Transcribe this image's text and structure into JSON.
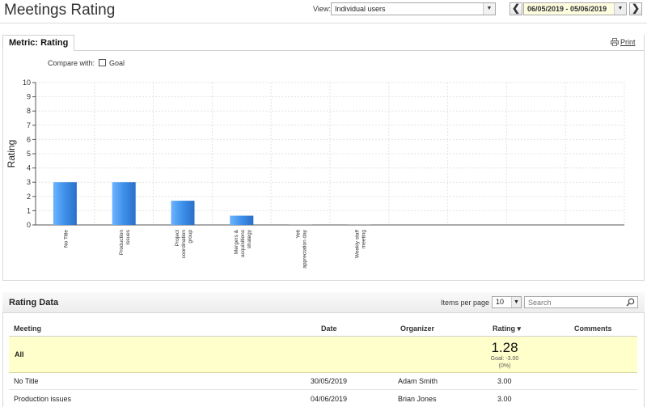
{
  "header": {
    "title": "Meetings Rating",
    "view_label": "View:",
    "view_value": "Individual users",
    "date_range": "06/05/2019 - 05/06/2019",
    "prev_glyph": "❮",
    "next_glyph": "❯"
  },
  "chart_panel": {
    "tab_label": "Metric: Rating",
    "print_label": "Print",
    "compare_label": "Compare with:",
    "goal_label": "Goal",
    "goal_checked": false
  },
  "chart_data": {
    "type": "bar",
    "ylabel": "Rating",
    "ylim": [
      0,
      10
    ],
    "yticks": [
      0,
      1,
      2,
      3,
      4,
      5,
      6,
      7,
      8,
      9,
      10
    ],
    "grid": true,
    "categories": [
      [
        "No Title"
      ],
      [
        "Production",
        "issues"
      ],
      [
        "Project",
        "coordination",
        "group"
      ],
      [
        "Mergers &",
        "acquisitions",
        "strategy"
      ],
      [
        "Yeti",
        "appreciation day"
      ],
      [
        "Weekly staff",
        "meeting"
      ],
      [],
      [],
      [],
      []
    ],
    "values": [
      3.0,
      3.0,
      1.7,
      0.65,
      0,
      0,
      null,
      null,
      null,
      null
    ],
    "bar_color": "#3d8fe8"
  },
  "data_panel": {
    "title": "Rating Data",
    "items_per_page_label": "Items per page",
    "items_per_page_value": "10",
    "search_placeholder": "Search",
    "columns": {
      "meeting": "Meeting",
      "date": "Date",
      "organizer": "Organizer",
      "rating": "Rating ▾",
      "comments": "Comments"
    },
    "summary": {
      "label": "All",
      "value": "1.28",
      "goal": "Goal: -3.00",
      "pct": "(0%)"
    },
    "rows": [
      {
        "meeting": "No Title",
        "date": "30/05/2019",
        "organizer": "Adam Smith",
        "rating": "3.00"
      },
      {
        "meeting": "Production issues",
        "date": "04/06/2019",
        "organizer": "Brian Jones",
        "rating": "3.00"
      }
    ]
  },
  "colors": {
    "summary_bg": "#ffffcc",
    "date_bg": "#fffde0"
  }
}
